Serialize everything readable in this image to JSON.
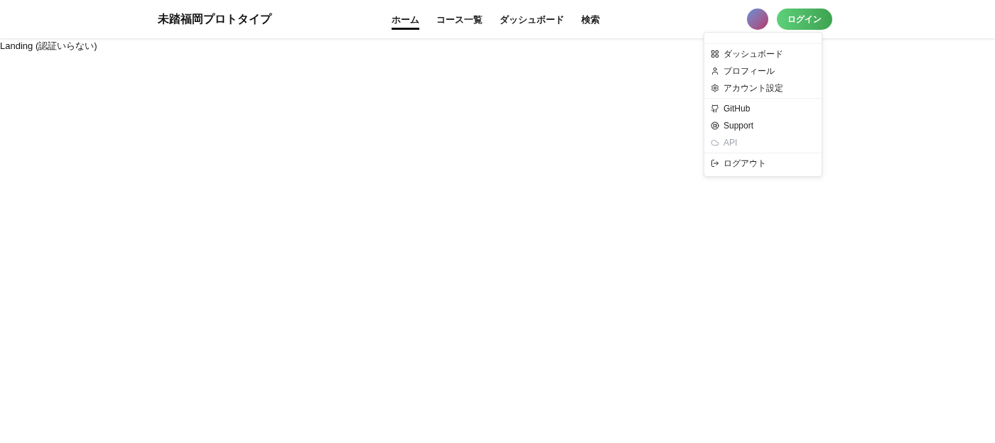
{
  "header": {
    "logo": "未踏福岡プロトタイプ",
    "nav": [
      {
        "label": "ホーム",
        "selected": true
      },
      {
        "label": "コース一覧",
        "selected": false
      },
      {
        "label": "ダッシュボード",
        "selected": false
      },
      {
        "label": "検索",
        "selected": false
      }
    ],
    "login_button": "ログイン"
  },
  "content": {
    "text": "Landing (認証いらない)"
  },
  "user_menu": {
    "groups": [
      [
        {
          "label": "ダッシュボード",
          "disabled": false
        },
        {
          "label": "プロフィール",
          "disabled": false
        },
        {
          "label": "アカウント設定",
          "disabled": false
        }
      ],
      [
        {
          "label": "GitHub",
          "disabled": false
        },
        {
          "label": "Support",
          "disabled": false
        },
        {
          "label": "API",
          "disabled": true
        }
      ],
      [
        {
          "label": "ログアウト",
          "disabled": false
        }
      ]
    ]
  }
}
